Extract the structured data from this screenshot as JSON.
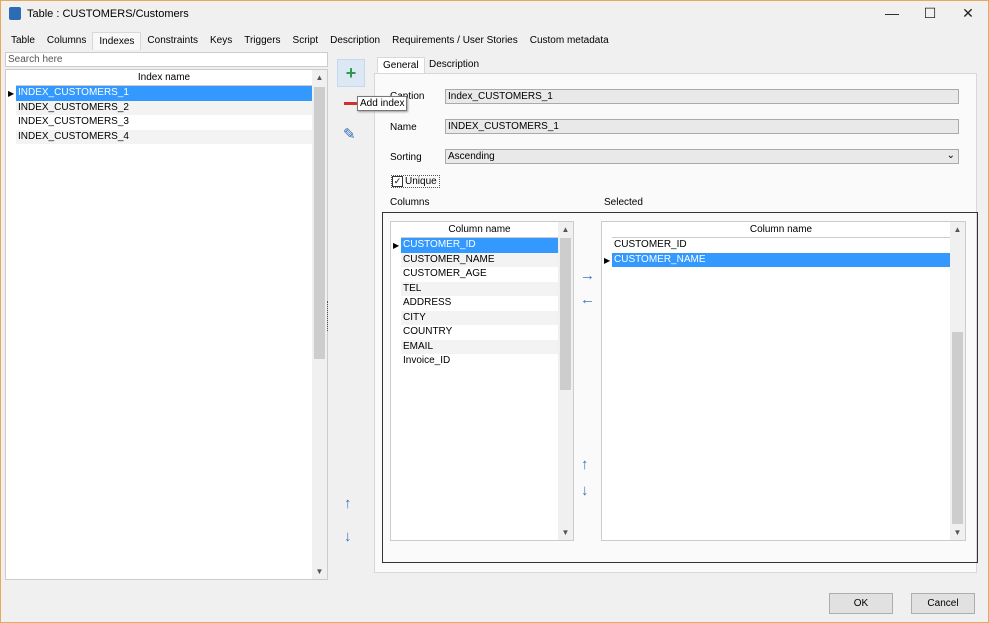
{
  "window": {
    "title": "Table : CUSTOMERS/Customers"
  },
  "tabs": [
    "Table",
    "Columns",
    "Indexes",
    "Constraints",
    "Keys",
    "Triggers",
    "Script",
    "Description",
    "Requirements / User Stories",
    "Custom metadata"
  ],
  "active_tab": "Indexes",
  "search": {
    "placeholder": "Search here"
  },
  "index_grid": {
    "header": "Index name",
    "rows": [
      "INDEX_CUSTOMERS_1",
      "INDEX_CUSTOMERS_2",
      "INDEX_CUSTOMERS_3",
      "INDEX_CUSTOMERS_4"
    ],
    "selected": 0
  },
  "tooltip": "Add index",
  "inner_tabs": [
    "General",
    "Description"
  ],
  "form": {
    "caption_label": "Caption",
    "caption_value": "Index_CUSTOMERS_1",
    "name_label": "Name",
    "name_value": "INDEX_CUSTOMERS_1",
    "sorting_label": "Sorting",
    "sorting_value": "Ascending",
    "unique_label": "Unique",
    "unique_checked": true
  },
  "columns": {
    "label": "Columns",
    "header": "Column name",
    "rows": [
      "CUSTOMER_ID",
      "CUSTOMER_NAME",
      "CUSTOMER_AGE",
      "TEL",
      "ADDRESS",
      "CITY",
      "COUNTRY",
      "EMAIL",
      "Invoice_ID"
    ],
    "selected": 0
  },
  "selected": {
    "label": "Selected",
    "header": "Column name",
    "rows": [
      "CUSTOMER_ID",
      "CUSTOMER_NAME"
    ],
    "selected": 1
  },
  "buttons": {
    "ok": "OK",
    "cancel": "Cancel"
  }
}
